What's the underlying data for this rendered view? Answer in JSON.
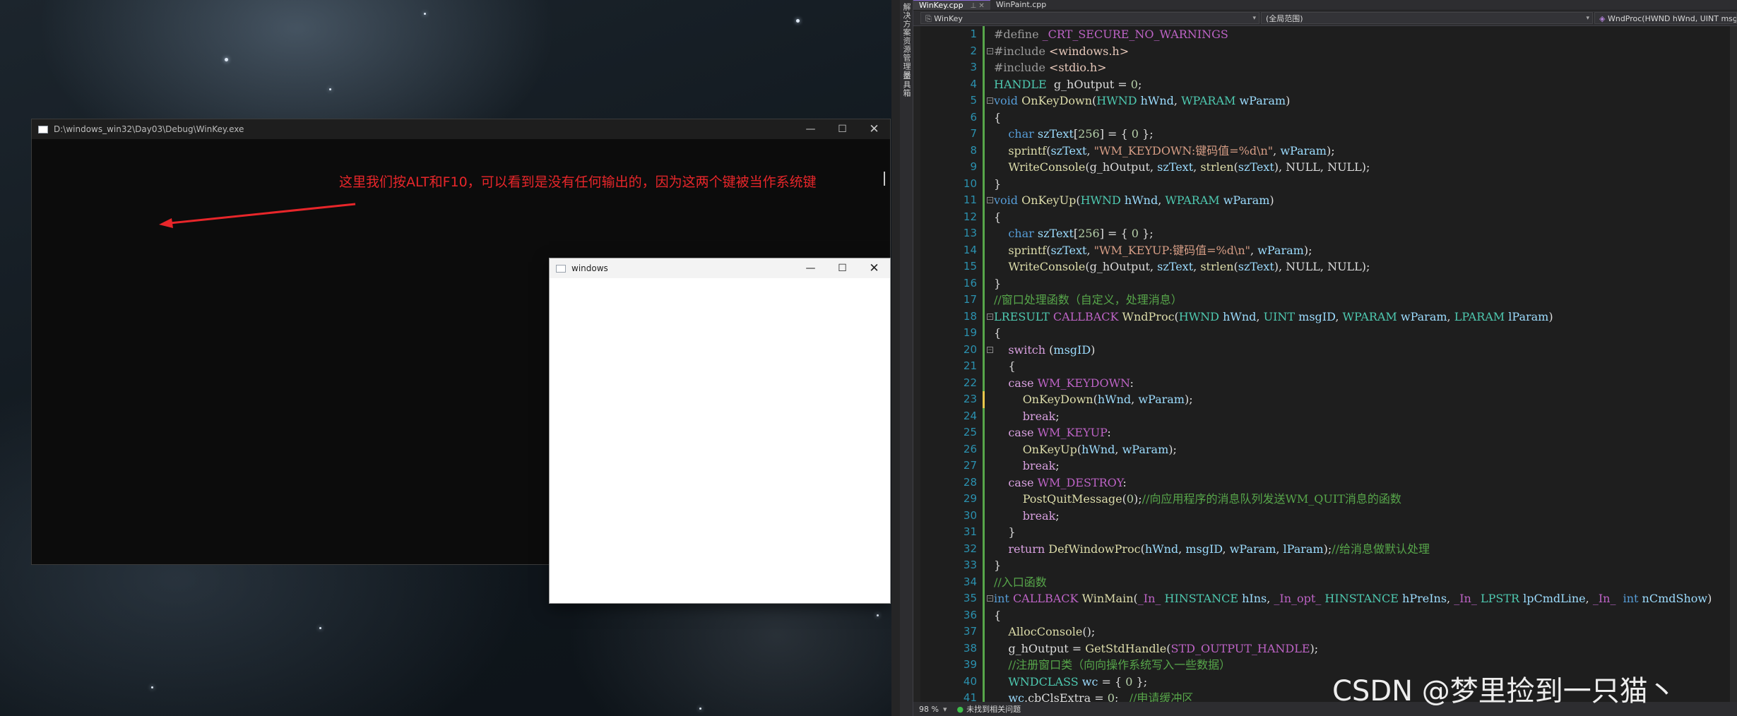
{
  "console_window": {
    "title": "D:\\windows_win32\\Day03\\Debug\\WinKey.exe",
    "annotation": "这里我们按ALT和F10，可以看到是没有任何输出的，因为这两个键被当作系统键"
  },
  "child_window": {
    "title": "windows"
  },
  "window_controls": {
    "minimize": "—",
    "maximize": "☐",
    "close": "✕"
  },
  "ide": {
    "side_labels": [
      "解决方案资源管理器",
      "工具箱"
    ],
    "tabs": [
      {
        "label": "WinKey.cpp",
        "active": true,
        "suffix": "⊥ ✕"
      },
      {
        "label": "WinPaint.cpp",
        "active": false
      }
    ],
    "nav": {
      "project": "WinKey",
      "scope": "(全局范围)",
      "member": "WndProc(HWND hWnd, UINT msgID, WPARAM wParam, LPARAM lParam)"
    },
    "code": [
      {
        "n": "1",
        "t": [
          [
            "pp",
            "#define "
          ],
          [
            "mac",
            "_CRT_SECURE_NO_WARNINGS"
          ]
        ]
      },
      {
        "n": "2",
        "fold": true,
        "t": [
          [
            "pp",
            "#include "
          ],
          [
            "inc",
            "<windows.h>"
          ]
        ]
      },
      {
        "n": "3",
        "t": [
          [
            "pp",
            "#include "
          ],
          [
            "inc",
            "<stdio.h>"
          ]
        ]
      },
      {
        "n": "4",
        "t": [
          [
            "ty",
            "HANDLE"
          ],
          [
            "",
            "  g_hOutput = "
          ],
          [
            "num",
            "0"
          ],
          [
            "",
            ";"
          ]
        ]
      },
      {
        "n": "5",
        "fold": true,
        "t": [
          [
            "kw",
            "void "
          ],
          [
            "fn",
            "OnKeyDown"
          ],
          [
            "",
            "("
          ],
          [
            "ty",
            "HWND"
          ],
          [
            "var",
            " hWnd"
          ],
          [
            "",
            ", "
          ],
          [
            "ty",
            "WPARAM"
          ],
          [
            "var",
            " wParam"
          ],
          [
            "",
            ")"
          ]
        ]
      },
      {
        "n": "6",
        "t": [
          [
            "",
            "{"
          ]
        ]
      },
      {
        "n": "7",
        "t": [
          [
            "",
            "    "
          ],
          [
            "kw",
            "char "
          ],
          [
            "var",
            "szText"
          ],
          [
            "",
            "["
          ],
          [
            "num",
            "256"
          ],
          [
            "",
            "] = { "
          ],
          [
            "num",
            "0"
          ],
          [
            "",
            " };"
          ]
        ]
      },
      {
        "n": "8",
        "t": [
          [
            "",
            "    "
          ],
          [
            "fn",
            "sprintf"
          ],
          [
            "",
            "("
          ],
          [
            "var",
            "szText"
          ],
          [
            "",
            ", "
          ],
          [
            "str",
            "\"WM_KEYDOWN:键码值=%d\\n\""
          ],
          [
            "",
            ", "
          ],
          [
            "var",
            "wParam"
          ],
          [
            "",
            ");"
          ]
        ]
      },
      {
        "n": "9",
        "t": [
          [
            "",
            "    "
          ],
          [
            "fn",
            "WriteConsole"
          ],
          [
            "",
            "(g_hOutput, "
          ],
          [
            "var",
            "szText"
          ],
          [
            "",
            ", "
          ],
          [
            "fn",
            "strlen"
          ],
          [
            "",
            "("
          ],
          [
            "var",
            "szText"
          ],
          [
            "",
            "), NULL, NULL);"
          ]
        ]
      },
      {
        "n": "10",
        "t": [
          [
            "",
            "}"
          ]
        ]
      },
      {
        "n": "11",
        "fold": true,
        "t": [
          [
            "kw",
            "void "
          ],
          [
            "fn",
            "OnKeyUp"
          ],
          [
            "",
            "("
          ],
          [
            "ty",
            "HWND"
          ],
          [
            "var",
            " hWnd"
          ],
          [
            "",
            ", "
          ],
          [
            "ty",
            "WPARAM"
          ],
          [
            "var",
            " wParam"
          ],
          [
            "",
            ")"
          ]
        ]
      },
      {
        "n": "12",
        "t": [
          [
            "",
            "{"
          ]
        ]
      },
      {
        "n": "13",
        "t": [
          [
            "",
            "    "
          ],
          [
            "kw",
            "char "
          ],
          [
            "var",
            "szText"
          ],
          [
            "",
            "["
          ],
          [
            "num",
            "256"
          ],
          [
            "",
            "] = { "
          ],
          [
            "num",
            "0"
          ],
          [
            "",
            " };"
          ]
        ]
      },
      {
        "n": "14",
        "t": [
          [
            "",
            "    "
          ],
          [
            "fn",
            "sprintf"
          ],
          [
            "",
            "("
          ],
          [
            "var",
            "szText"
          ],
          [
            "",
            ", "
          ],
          [
            "str",
            "\"WM_KEYUP:键码值=%d\\n\""
          ],
          [
            "",
            ", "
          ],
          [
            "var",
            "wParam"
          ],
          [
            "",
            ");"
          ]
        ]
      },
      {
        "n": "15",
        "t": [
          [
            "",
            "    "
          ],
          [
            "fn",
            "WriteConsole"
          ],
          [
            "",
            "(g_hOutput, "
          ],
          [
            "var",
            "szText"
          ],
          [
            "",
            ", "
          ],
          [
            "fn",
            "strlen"
          ],
          [
            "",
            "("
          ],
          [
            "var",
            "szText"
          ],
          [
            "",
            "), NULL, NULL);"
          ]
        ]
      },
      {
        "n": "16",
        "t": [
          [
            "",
            "}"
          ]
        ]
      },
      {
        "n": "17",
        "t": [
          [
            "cm",
            "//窗口处理函数（自定义，处理消息）"
          ]
        ]
      },
      {
        "n": "18",
        "fold": true,
        "t": [
          [
            "ty",
            "LRESULT"
          ],
          [
            "mac",
            " CALLBACK "
          ],
          [
            "fn",
            "WndProc"
          ],
          [
            "",
            "("
          ],
          [
            "ty",
            "HWND"
          ],
          [
            "var",
            " hWnd"
          ],
          [
            "",
            ", "
          ],
          [
            "ty",
            "UINT"
          ],
          [
            "var",
            " msgID"
          ],
          [
            "",
            ", "
          ],
          [
            "ty",
            "WPARAM"
          ],
          [
            "var",
            " wParam"
          ],
          [
            "",
            ", "
          ],
          [
            "ty",
            "LPARAM"
          ],
          [
            "var",
            " lParam"
          ],
          [
            "",
            ")"
          ]
        ]
      },
      {
        "n": "19",
        "t": [
          [
            "",
            "{"
          ]
        ]
      },
      {
        "n": "20",
        "fold": true,
        "t": [
          [
            "",
            "    "
          ],
          [
            "ctrl",
            "switch"
          ],
          [
            "",
            " ("
          ],
          [
            "var",
            "msgID"
          ],
          [
            "",
            ")"
          ]
        ]
      },
      {
        "n": "21",
        "t": [
          [
            "",
            "    {"
          ]
        ]
      },
      {
        "n": "22",
        "t": [
          [
            "",
            "    "
          ],
          [
            "ctrl",
            "case "
          ],
          [
            "mac",
            "WM_KEYDOWN"
          ],
          [
            "",
            ":"
          ]
        ]
      },
      {
        "n": "23",
        "t": [
          [
            "",
            "        "
          ],
          [
            "fn",
            "OnKeyDown"
          ],
          [
            "",
            "("
          ],
          [
            "var",
            "hWnd"
          ],
          [
            "",
            ", "
          ],
          [
            "var",
            "wParam"
          ],
          [
            "",
            ");"
          ]
        ]
      },
      {
        "n": "24",
        "t": [
          [
            "",
            "        "
          ],
          [
            "ctrl",
            "break"
          ],
          [
            "",
            ";"
          ]
        ]
      },
      {
        "n": "25",
        "t": [
          [
            "",
            "    "
          ],
          [
            "ctrl",
            "case "
          ],
          [
            "mac",
            "WM_KEYUP"
          ],
          [
            "",
            ":"
          ]
        ]
      },
      {
        "n": "26",
        "t": [
          [
            "",
            "        "
          ],
          [
            "fn",
            "OnKeyUp"
          ],
          [
            "",
            "("
          ],
          [
            "var",
            "hWnd"
          ],
          [
            "",
            ", "
          ],
          [
            "var",
            "wParam"
          ],
          [
            "",
            ");"
          ]
        ]
      },
      {
        "n": "27",
        "t": [
          [
            "",
            "        "
          ],
          [
            "ctrl",
            "break"
          ],
          [
            "",
            ";"
          ]
        ]
      },
      {
        "n": "28",
        "t": [
          [
            "",
            "    "
          ],
          [
            "ctrl",
            "case "
          ],
          [
            "mac",
            "WM_DESTROY"
          ],
          [
            "",
            ":"
          ]
        ]
      },
      {
        "n": "29",
        "t": [
          [
            "",
            "        "
          ],
          [
            "fn",
            "PostQuitMessage"
          ],
          [
            "",
            "("
          ],
          [
            "num",
            "0"
          ],
          [
            "",
            ");"
          ],
          [
            "cm",
            "//向应用程序的消息队列发送WM_QUIT消息的函数"
          ]
        ]
      },
      {
        "n": "30",
        "t": [
          [
            "",
            "        "
          ],
          [
            "ctrl",
            "break"
          ],
          [
            "",
            ";"
          ]
        ]
      },
      {
        "n": "31",
        "t": [
          [
            "",
            "    }"
          ]
        ]
      },
      {
        "n": "32",
        "t": [
          [
            "",
            "    "
          ],
          [
            "ctrl",
            "return "
          ],
          [
            "fn",
            "DefWindowProc"
          ],
          [
            "",
            "("
          ],
          [
            "var",
            "hWnd"
          ],
          [
            "",
            ", "
          ],
          [
            "var",
            "msgID"
          ],
          [
            "",
            ", "
          ],
          [
            "var",
            "wParam"
          ],
          [
            "",
            ", "
          ],
          [
            "var",
            "lParam"
          ],
          [
            "",
            ");"
          ],
          [
            "cm",
            "//给消息做默认处理"
          ]
        ]
      },
      {
        "n": "33",
        "t": [
          [
            "",
            "}"
          ]
        ]
      },
      {
        "n": "34",
        "t": [
          [
            "cm",
            "//入口函数"
          ]
        ]
      },
      {
        "n": "35",
        "fold": true,
        "t": [
          [
            "kw",
            "int "
          ],
          [
            "mac",
            "CALLBACK "
          ],
          [
            "fn",
            "WinMain"
          ],
          [
            "",
            "("
          ],
          [
            "mac",
            "_In_ "
          ],
          [
            "ty",
            "HINSTANCE"
          ],
          [
            "var",
            " hIns"
          ],
          [
            "",
            ", "
          ],
          [
            "mac",
            "_In_opt_ "
          ],
          [
            "ty",
            "HINSTANCE"
          ],
          [
            "var",
            " hPreIns"
          ],
          [
            "",
            ", "
          ],
          [
            "mac",
            "_In_ "
          ],
          [
            "ty",
            "LPSTR"
          ],
          [
            "var",
            " lpCmdLine"
          ],
          [
            "",
            ", "
          ],
          [
            "mac",
            "_In_ "
          ],
          [
            "kw",
            " int"
          ],
          [
            "var",
            " nCmdShow"
          ],
          [
            "",
            ")"
          ]
        ]
      },
      {
        "n": "36",
        "t": [
          [
            "",
            "{"
          ]
        ]
      },
      {
        "n": "37",
        "t": [
          [
            "",
            "    "
          ],
          [
            "fn",
            "AllocConsole"
          ],
          [
            "",
            "();"
          ]
        ]
      },
      {
        "n": "38",
        "t": [
          [
            "",
            "    g_hOutput = "
          ],
          [
            "fn",
            "GetStdHandle"
          ],
          [
            "",
            "("
          ],
          [
            "mac",
            "STD_OUTPUT_HANDLE"
          ],
          [
            "",
            ");"
          ]
        ]
      },
      {
        "n": "39",
        "t": [
          [
            "",
            "    "
          ],
          [
            "cm",
            "//注册窗口类（向向操作系统写入一些数据）"
          ]
        ]
      },
      {
        "n": "40",
        "t": [
          [
            "",
            "    "
          ],
          [
            "ty",
            "WNDCLASS"
          ],
          [
            "var",
            " wc"
          ],
          [
            "",
            " = { "
          ],
          [
            "num",
            "0"
          ],
          [
            "",
            " };"
          ]
        ]
      },
      {
        "n": "41",
        "t": [
          [
            "",
            "    "
          ],
          [
            "var",
            "wc"
          ],
          [
            "",
            ".cbClsExtra = "
          ],
          [
            "num",
            "0"
          ],
          [
            "",
            ";   "
          ],
          [
            "cm",
            "//申请缓冲区"
          ]
        ]
      }
    ],
    "status": {
      "zoom": "98 %",
      "issues": "未找到相关问题"
    },
    "watermark": "CSDN @梦里捡到一只猫丶"
  },
  "colors": {
    "annotation_red": "#e8262a",
    "console_bg": "#0c0c0c",
    "ide_bg": "#1e1e1e"
  }
}
